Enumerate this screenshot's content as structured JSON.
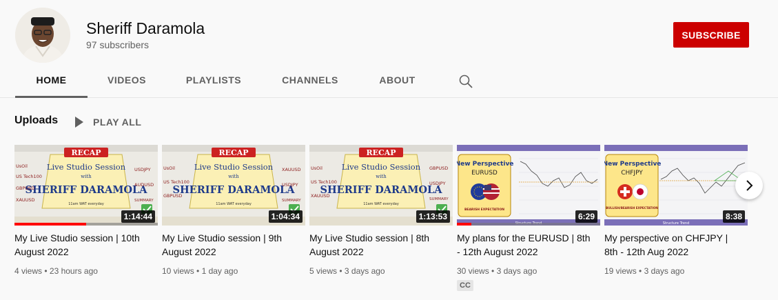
{
  "channel": {
    "name": "Sheriff Daramola",
    "subscribers": "97 subscribers",
    "subscribe_label": "SUBSCRIBE"
  },
  "tabs": [
    {
      "label": "HOME",
      "active": true
    },
    {
      "label": "VIDEOS"
    },
    {
      "label": "PLAYLISTS"
    },
    {
      "label": "CHANNELS"
    },
    {
      "label": "ABOUT"
    }
  ],
  "uploads": {
    "title": "Uploads",
    "play_all_label": "PLAY ALL"
  },
  "videos": [
    {
      "title": "My Live Studio session | 10th August 2022",
      "views": "4 views",
      "age": "23 hours ago",
      "duration": "1:14:44",
      "watched_fraction": 0.5,
      "thumbnail": {
        "type": "recap",
        "banner": "RECAP",
        "line1": "Live Studio Session",
        "line2": "with",
        "name": "SHERIFF DARAMOLA",
        "footer": "11am WAT everyday",
        "left": [
          "UsOil",
          "US Tech100",
          "GBPUSD",
          "XAUUSD"
        ],
        "right": [
          "USDJPY",
          "AUDUSD",
          "SUMMARY"
        ]
      }
    },
    {
      "title": "My Live Studio session | 9th August 2022",
      "views": "10 views",
      "age": "1 day ago",
      "duration": "1:04:34",
      "thumbnail": {
        "type": "recap",
        "banner": "RECAP",
        "line1": "Live Studio Session",
        "line2": "with",
        "name": "SHERIFF DARAMOLA",
        "footer": "11am WAT everyday",
        "left": [
          "UsOil",
          "US Tech100",
          "GBPUSD"
        ],
        "right": [
          "XAUUSD",
          "USDJPY",
          "SUMMARY"
        ]
      }
    },
    {
      "title": "My Live Studio session | 8th August 2022",
      "views": "5 views",
      "age": "3 days ago",
      "duration": "1:13:53",
      "thumbnail": {
        "type": "recap",
        "banner": "RECAP",
        "line1": "Live Studio Session",
        "line2": "with",
        "name": "SHERIFF DARAMOLA",
        "footer": "11am WAT everyday",
        "left": [
          "UsOil",
          "US Tech100",
          "XAUUSD"
        ],
        "right": [
          "GBPUSD",
          "USDJPY",
          "SUMMARY"
        ]
      }
    },
    {
      "title": "My plans for the EURUSD | 8th - 12th August 2022",
      "views": "30 views",
      "age": "3 days ago",
      "duration": "6:29",
      "watched_fraction": 0.1,
      "cc": "CC",
      "thumbnail": {
        "type": "perspective",
        "heading": "New Perspective",
        "pair": "EURUSD",
        "caption": "BEARISH EXPECTATION",
        "bottom": "Structure Trend"
      }
    },
    {
      "title": "My perspective on CHFJPY | 8th - 12th Aug 2022",
      "views": "19 views",
      "age": "3 days ago",
      "duration": "8:38",
      "thumbnail": {
        "type": "perspective",
        "heading": "New Perspective",
        "pair": "CHFJPY",
        "caption": "BULLISH/BEARISH EXPECTATION",
        "bottom": "Structure Trend"
      }
    }
  ],
  "colors": {
    "subscribe": "#cc0000",
    "progress": "#ff0000",
    "recap_banner": "#cc2222",
    "recap_text": "#1e3a8a",
    "perspective_header": "#7b6fb8",
    "perspective_card": "#fde68a"
  },
  "icons": {
    "search": "search-icon",
    "play_all": "play-icon",
    "next": "chevron-right-icon",
    "check": "check-icon"
  }
}
